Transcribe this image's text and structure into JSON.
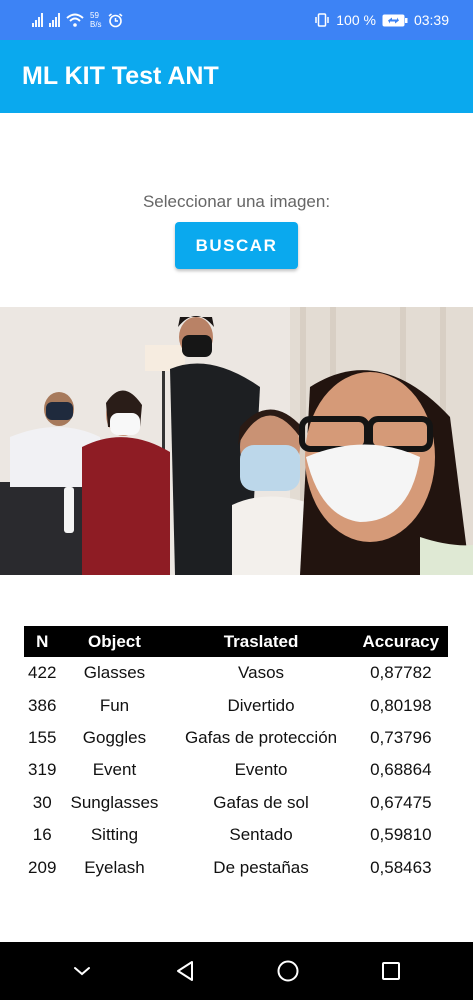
{
  "status_bar": {
    "speed_value": "59",
    "speed_unit": "B/s",
    "battery": "100 %",
    "time": "03:39"
  },
  "app_bar": {
    "title": "ML KIT Test ANT"
  },
  "content": {
    "select_label": "Seleccionar una imagen:",
    "search_button": "BUSCAR"
  },
  "table": {
    "headers": [
      "N",
      "Object",
      "Traslated",
      "Accuracy"
    ],
    "rows": [
      [
        "422",
        "Glasses",
        "Vasos",
        "0,87782"
      ],
      [
        "386",
        "Fun",
        "Divertido",
        "0,80198"
      ],
      [
        "155",
        "Goggles",
        "Gafas de protección",
        "0,73796"
      ],
      [
        "319",
        "Event",
        "Evento",
        "0,68864"
      ],
      [
        "30",
        "Sunglasses",
        "Gafas de sol",
        "0,67475"
      ],
      [
        "16",
        "Sitting",
        "Sentado",
        "0,59810"
      ],
      [
        "209",
        "Eyelash",
        "De pestañas",
        "0,58463"
      ]
    ]
  },
  "colors": {
    "status_bar": "#3d83f5",
    "app_bar": "#0aa9ee",
    "button": "#0aa9ee",
    "table_header": "#000000",
    "nav_bar": "#000000"
  }
}
